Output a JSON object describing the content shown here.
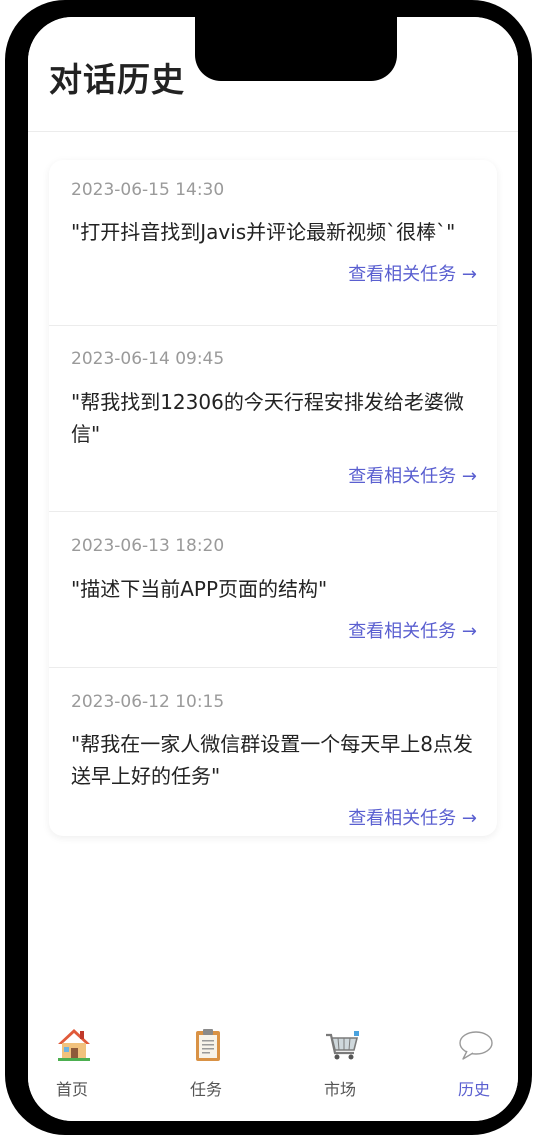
{
  "header": {
    "title": "对话历史"
  },
  "history": {
    "items": [
      {
        "time": "2023-06-15 14:30",
        "text": "\"打开抖音找到Javis并评论最新视频`很棒`\"",
        "link": "查看相关任务 →"
      },
      {
        "time": "2023-06-14 09:45",
        "text": "\"帮我找到12306的今天行程安排发给老婆微信\"",
        "link": "查看相关任务 →"
      },
      {
        "time": "2023-06-13 18:20",
        "text": "\"描述下当前APP页面的结构\"",
        "link": "查看相关任务 →"
      },
      {
        "time": "2023-06-12 10:15",
        "text": "\"帮我在一家人微信群设置一个每天早上8点发送早上好的任务\"",
        "link": "查看相关任务 →"
      }
    ]
  },
  "tabbar": {
    "tabs": [
      {
        "label": "首页",
        "icon": "house-icon",
        "active": false
      },
      {
        "label": "任务",
        "icon": "clipboard-icon",
        "active": false
      },
      {
        "label": "市场",
        "icon": "shopping-cart-icon",
        "active": false
      },
      {
        "label": "历史",
        "icon": "speech-bubble-icon",
        "active": true
      }
    ]
  },
  "colors": {
    "accent": "#5a5fd0",
    "text": "#222222",
    "muted": "#9a9a9a",
    "frame": "#000000"
  }
}
